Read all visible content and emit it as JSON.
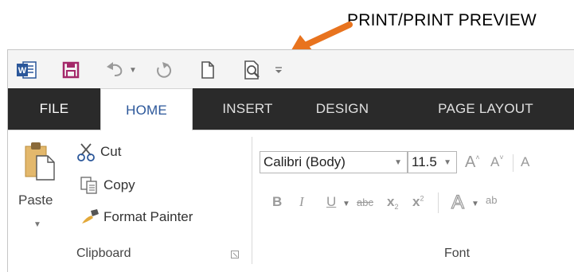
{
  "annotation": {
    "text": "PRINT/PRINT PREVIEW",
    "arrow_color": "#e8731e"
  },
  "quick_access": {
    "items": [
      {
        "name": "word-logo-icon"
      },
      {
        "name": "save-icon"
      },
      {
        "name": "undo-icon"
      },
      {
        "name": "undo-dropdown-icon"
      },
      {
        "name": "redo-icon"
      },
      {
        "name": "new-document-icon"
      },
      {
        "name": "print-preview-icon"
      },
      {
        "name": "customize-qat-icon"
      }
    ],
    "save_color": "#a4286a"
  },
  "tabs": {
    "items": [
      "FILE",
      "HOME",
      "INSERT",
      "DESIGN",
      "PAGE LAYOUT"
    ],
    "active": "HOME",
    "file_bg": "#2a2a2a",
    "active_color": "#2b579a"
  },
  "clipboard": {
    "paste_label": "Paste",
    "cut_label": "Cut",
    "copy_label": "Copy",
    "format_painter_label": "Format Painter",
    "group_label": "Clipboard"
  },
  "font": {
    "font_name": "Calibri (Body)",
    "font_size": "11.5",
    "grow_label": "A",
    "shrink_label": "A",
    "bold_label": "B",
    "italic_label": "I",
    "underline_label": "U",
    "strikethrough_label": "abc",
    "subscript_label": "x",
    "subscript_mark": "2",
    "superscript_label": "x",
    "superscript_mark": "2",
    "group_label": "Font"
  }
}
